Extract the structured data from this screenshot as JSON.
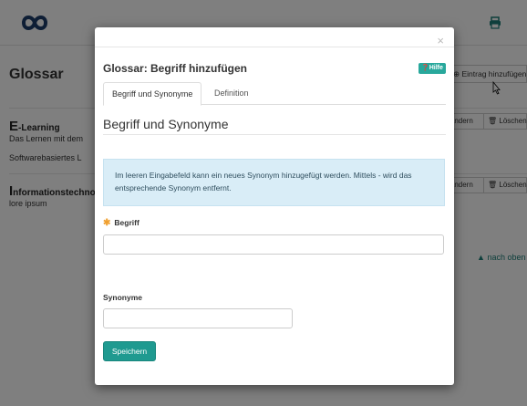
{
  "background": {
    "page_title": "Glossar",
    "add_entry_label": "Eintrag hinzufügen",
    "entries": [
      {
        "head_initial": "E",
        "head_rest": "-Learning",
        "lines": [
          "Das Lernen mit dem",
          "Softwarebasiertes L"
        ],
        "edit_label": "Ändern",
        "delete_label": "Löschen"
      },
      {
        "head_initial": "I",
        "head_rest": "nformationstechno",
        "lines": [
          "lore ipsum"
        ],
        "edit_label": "Ändern",
        "delete_label": "Löschen"
      }
    ],
    "back_to_top_label": "nach oben",
    "colors": {
      "accent": "#1c7f78",
      "logo": "#1c3d6b"
    }
  },
  "modal": {
    "title": "Glossar: Begriff hinzufügen",
    "help_label": "Hilfe",
    "close_glyph": "×",
    "tabs": [
      {
        "label": "Begriff und Synonyme",
        "active": true
      },
      {
        "label": "Definition",
        "active": false
      }
    ],
    "section_title": "Begriff und Synonyme",
    "info_text": "Im leeren Eingabefeld kann ein neues Synonym hinzugefügt werden. Mittels - wird das entsprechende Synonym entfernt.",
    "term_label": "Begriff",
    "term_required_mark": "✱",
    "term_value": "",
    "synonyms_label": "Synonyme",
    "synonym_value": "",
    "save_label": "Speichern",
    "colors": {
      "primary": "#1f9a90",
      "info_bg": "#d9edf7",
      "required": "#f0a030"
    }
  }
}
